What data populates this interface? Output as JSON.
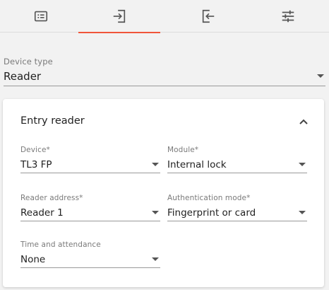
{
  "tabs": [
    {
      "icon": "list-card-icon",
      "active": false
    },
    {
      "icon": "entry-arrow-icon",
      "active": true
    },
    {
      "icon": "exit-arrow-icon",
      "active": false
    },
    {
      "icon": "sliders-icon",
      "active": false
    }
  ],
  "accent_color": "#f0553a",
  "device_type": {
    "label": "Device type",
    "value": "Reader"
  },
  "entry_reader": {
    "title": "Entry reader",
    "device": {
      "label": "Device*",
      "value": "TL3 FP"
    },
    "module": {
      "label": "Module*",
      "value": "Internal lock"
    },
    "reader_address": {
      "label": "Reader address*",
      "value": "Reader 1"
    },
    "authentication_mode": {
      "label": "Authentication mode*",
      "value": "Fingerprint or card"
    },
    "time_and_attendance": {
      "label": "Time and attendance",
      "value": "None"
    }
  }
}
